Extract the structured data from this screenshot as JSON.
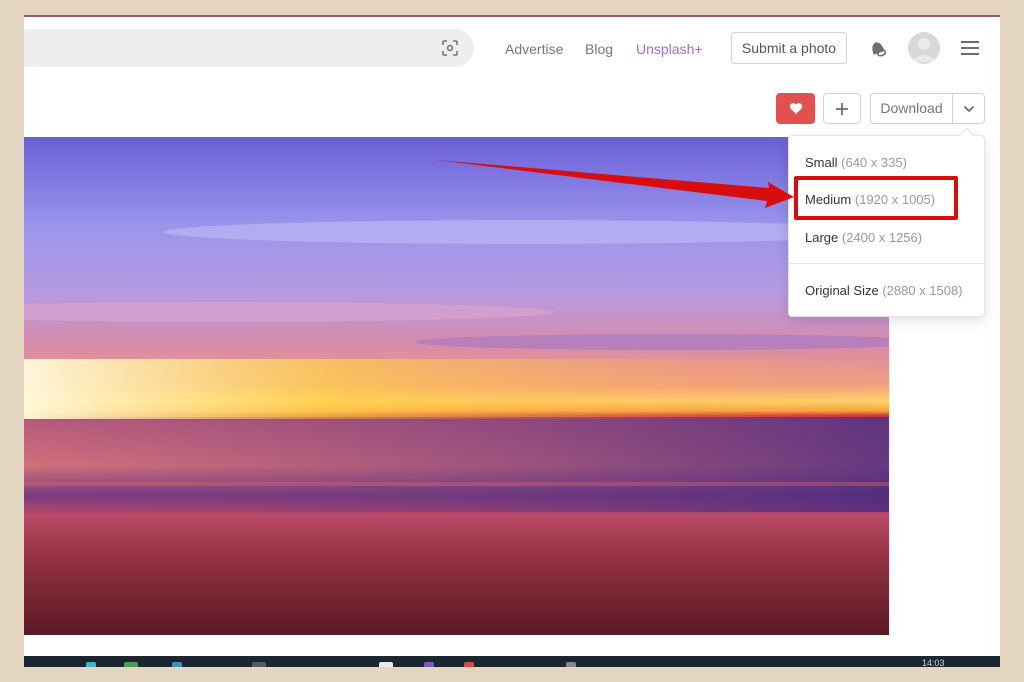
{
  "header": {
    "search": {
      "value": "",
      "placeholder": "",
      "visual_search_icon": "visual-search-icon"
    },
    "nav": [
      {
        "label": "Advertise"
      },
      {
        "label": "Blog"
      },
      {
        "label": "Unsplash+"
      }
    ],
    "submit_label": "Submit a photo",
    "notifications_icon": "bell-icon",
    "avatar_icon": "user-avatar",
    "menu_icon": "hamburger-menu-icon"
  },
  "actions": {
    "like_icon": "heart-icon",
    "add_icon": "plus-icon",
    "download_label": "Download",
    "download_menu_icon": "chevron-down-icon"
  },
  "photo": {
    "description": "Long-exposure sunset over beach with purple and orange sky"
  },
  "download_menu": {
    "items": [
      {
        "label": "Small",
        "dims": "(640 x 335)"
      },
      {
        "label": "Medium",
        "dims": "(1920 x 1005)",
        "highlighted": true
      },
      {
        "label": "Large",
        "dims": "(2400 x 1256)"
      },
      {
        "label": "Original Size",
        "dims": "(2880 x 1508)"
      }
    ]
  },
  "annotation": {
    "color": "#d90d0d",
    "target": "Medium (1920 x 1005)"
  },
  "colors": {
    "like_red": "#e25050",
    "unsplash_plus_purple": "#a36ad8",
    "page_border": "#e3d5bf"
  },
  "taskbar": {
    "clock": "14:03"
  }
}
